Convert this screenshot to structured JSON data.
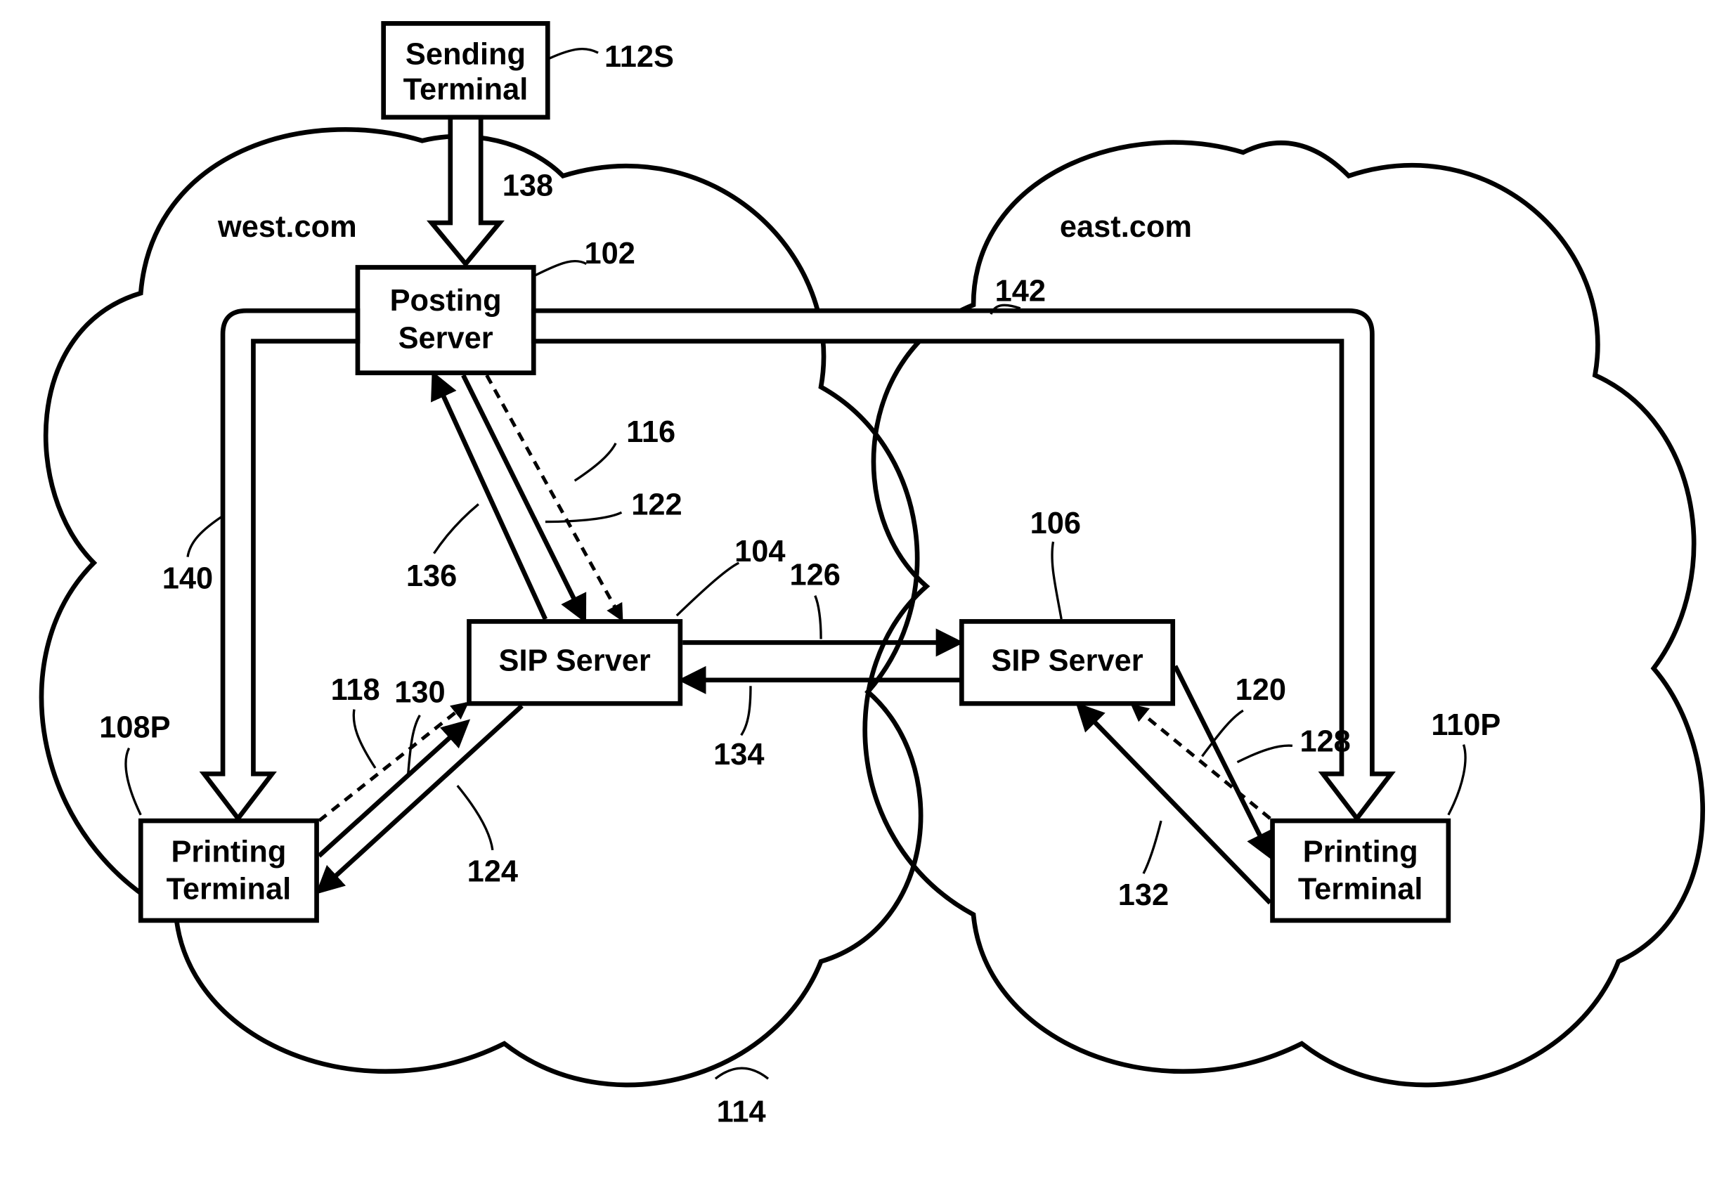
{
  "clouds": {
    "west_label": "west.com",
    "east_label": "east.com"
  },
  "boxes": {
    "sending_terminal_l1": "Sending",
    "sending_terminal_l2": "Terminal",
    "posting_server_l1": "Posting",
    "posting_server_l2": "Server",
    "sip_west": "SIP Server",
    "sip_east": "SIP Server",
    "printing_west_l1": "Printing",
    "printing_west_l2": "Terminal",
    "printing_east_l1": "Printing",
    "printing_east_l2": "Terminal"
  },
  "refs": {
    "r102": "102",
    "r104": "104",
    "r106": "106",
    "r108P": "108P",
    "r110P": "110P",
    "r112S": "112S",
    "r114": "114",
    "r116": "116",
    "r118": "118",
    "r120": "120",
    "r122": "122",
    "r124": "124",
    "r126": "126",
    "r128": "128",
    "r130": "130",
    "r132": "132",
    "r134": "134",
    "r136": "136",
    "r138": "138",
    "r140": "140",
    "r142": "142"
  }
}
